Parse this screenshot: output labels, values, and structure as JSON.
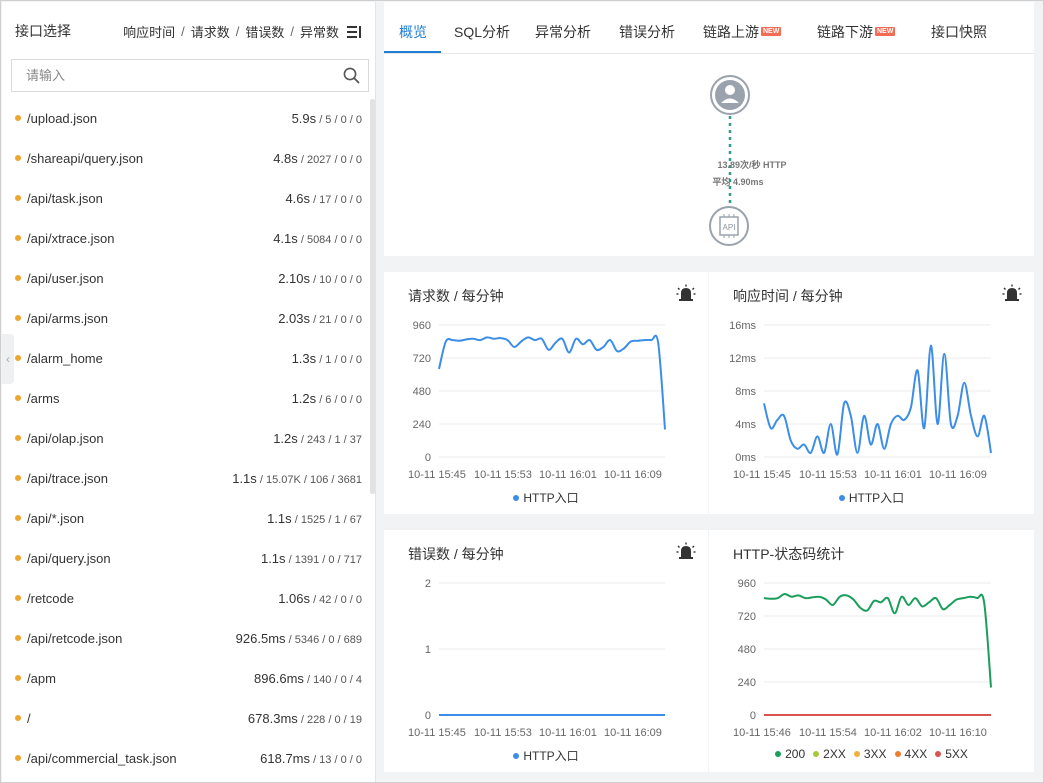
{
  "sidebar": {
    "title": "接口选择",
    "sort": {
      "response_time": "响应时间",
      "requests": "请求数",
      "errors": "错误数",
      "exceptions": "异常数",
      "separator": "/",
      "menu_icon": "list-menu-icon"
    },
    "search_placeholder": "请输入",
    "items": [
      {
        "name": "/upload.json",
        "time": "5.9s",
        "counts": " / 5 / 0 / 0"
      },
      {
        "name": "/shareapi/query.json",
        "time": "4.8s",
        "counts": " / 2027 / 0 / 0"
      },
      {
        "name": "/api/task.json",
        "time": "4.6s",
        "counts": " / 17 / 0 / 0"
      },
      {
        "name": "/api/xtrace.json",
        "time": "4.1s",
        "counts": " / 5084 / 0 / 0"
      },
      {
        "name": "/api/user.json",
        "time": "2.10s",
        "counts": " / 10 / 0 / 0"
      },
      {
        "name": "/api/arms.json",
        "time": "2.03s",
        "counts": " / 21 / 0 / 0"
      },
      {
        "name": "/alarm_home",
        "time": "1.3s",
        "counts": " / 1 / 0 / 0"
      },
      {
        "name": "/arms",
        "time": "1.2s",
        "counts": " / 6 / 0 / 0"
      },
      {
        "name": "/api/olap.json",
        "time": "1.2s",
        "counts": " / 243 / 1 / 37"
      },
      {
        "name": "/api/trace.json",
        "time": "1.1s",
        "counts": " / 15.07K / 106 / 3681"
      },
      {
        "name": "/api/*.json",
        "time": "1.1s",
        "counts": " / 1525 / 1 / 67"
      },
      {
        "name": "/api/query.json",
        "time": "1.1s",
        "counts": " / 1391 / 0 / 717"
      },
      {
        "name": "/retcode",
        "time": "1.06s",
        "counts": " / 42 / 0 / 0"
      },
      {
        "name": "/api/retcode.json",
        "time": "926.5ms",
        "counts": " / 5346 / 0 / 689"
      },
      {
        "name": "/apm",
        "time": "896.6ms",
        "counts": " / 140 / 0 / 4"
      },
      {
        "name": "/",
        "time": "678.3ms",
        "counts": " / 228 / 0 / 19"
      },
      {
        "name": "/api/commercial_task.json",
        "time": "618.7ms",
        "counts": " / 13 / 0 / 0"
      }
    ]
  },
  "tabs": [
    {
      "label": "概览",
      "active": true
    },
    {
      "label": "SQL分析"
    },
    {
      "label": "异常分析"
    },
    {
      "label": "错误分析"
    },
    {
      "label": "链路上游",
      "badge": "NEW"
    },
    {
      "label": "链路下游",
      "badge": "NEW"
    },
    {
      "label": "接口快照"
    }
  ],
  "topology": {
    "source_icon": "user-icon",
    "target_icon": "api-chip-icon",
    "target_label": "API",
    "rate_text": "13.89次/秒 HTTP",
    "avg_text": "平均 4.90ms",
    "edge_color": "#2a9d8f"
  },
  "colors": {
    "accent": "#1f7ed6",
    "series_blue": "#3b8de8",
    "status_200": "#1a9e5c",
    "status_2xx": "#a5c93b",
    "status_3xx": "#f0b03c",
    "status_4xx": "#f07d2e",
    "status_5xx": "#d9534f",
    "list_dot": "#f0a431"
  },
  "chart_data": [
    {
      "id": "requests",
      "type": "line",
      "title": "请求数 / 每分钟",
      "alarm_icon": "alarm-bell-icon",
      "yticks": [
        "960",
        "720",
        "480",
        "240",
        "0"
      ],
      "ylim": [
        0,
        960
      ],
      "xticks": [
        "10-11 15:45",
        "10-11 15:53",
        "10-11 16:01",
        "10-11 16:09"
      ],
      "series": [
        {
          "name": "HTTP入口",
          "color": "#3b8de8",
          "values": [
            640,
            840,
            850,
            845,
            855,
            860,
            850,
            870,
            860,
            865,
            850,
            800,
            840,
            870,
            850,
            860,
            780,
            830,
            860,
            760,
            860,
            820,
            850,
            780,
            800,
            850,
            770,
            790,
            840,
            845,
            850,
            850,
            830,
            200
          ]
        }
      ]
    },
    {
      "id": "response_time",
      "type": "line",
      "title": "响应时间 / 每分钟",
      "alarm_icon": "alarm-bell-icon",
      "yticks": [
        "16ms",
        "12ms",
        "8ms",
        "4ms",
        "0ms"
      ],
      "ylim": [
        0,
        16
      ],
      "xticks": [
        "10-11 15:45",
        "10-11 15:53",
        "10-11 16:01",
        "10-11 16:09"
      ],
      "series": [
        {
          "name": "HTTP入口",
          "color": "#3b8de8",
          "values": [
            6.5,
            3.5,
            4.5,
            5,
            2,
            1,
            1.5,
            0.5,
            2.5,
            0.5,
            4,
            0.3,
            6.5,
            5,
            0.5,
            5,
            1.5,
            4,
            1,
            4,
            5,
            4.5,
            6,
            10.5,
            3.5,
            13.5,
            4,
            12.5,
            4,
            5,
            9,
            5,
            2.5,
            5,
            0.5
          ]
        }
      ]
    },
    {
      "id": "errors",
      "type": "line",
      "title": "错误数 / 每分钟",
      "alarm_icon": "alarm-bell-icon",
      "yticks": [
        "2",
        "1",
        "0"
      ],
      "ylim": [
        0,
        2
      ],
      "xticks": [
        "10-11 15:45",
        "10-11 15:53",
        "10-11 16:01",
        "10-11 16:09"
      ],
      "series": [
        {
          "name": "HTTP入口",
          "color": "#3b8de8",
          "values": [
            0,
            0,
            0,
            0,
            0,
            0,
            0,
            0,
            0,
            0,
            0,
            0
          ]
        }
      ]
    },
    {
      "id": "status_codes",
      "type": "line",
      "title": "HTTP-状态码统计",
      "yticks": [
        "960",
        "720",
        "480",
        "240",
        "0"
      ],
      "ylim": [
        0,
        960
      ],
      "xticks": [
        "10-11 15:46",
        "10-11 15:54",
        "10-11 16:02",
        "10-11 16:10"
      ],
      "series": [
        {
          "name": "200",
          "color": "#1a9e5c",
          "values": [
            850,
            845,
            850,
            880,
            860,
            870,
            850,
            855,
            860,
            840,
            800,
            860,
            870,
            840,
            780,
            760,
            830,
            820,
            850,
            740,
            860,
            800,
            850,
            790,
            820,
            850,
            770,
            800,
            840,
            850,
            860,
            850,
            820,
            200
          ]
        },
        {
          "name": "2XX",
          "color": "#a5c93b",
          "values": [
            0,
            0,
            0,
            0,
            0,
            0,
            0,
            0,
            0,
            0,
            0,
            0
          ]
        },
        {
          "name": "3XX",
          "color": "#f0b03c",
          "values": [
            0,
            0,
            0,
            0,
            0,
            0,
            0,
            0,
            0,
            0,
            0,
            0
          ]
        },
        {
          "name": "4XX",
          "color": "#f07d2e",
          "values": [
            0,
            0,
            0,
            0,
            0,
            0,
            0,
            0,
            0,
            0,
            0,
            0
          ]
        },
        {
          "name": "5XX",
          "color": "#d9534f",
          "values": [
            0,
            0,
            0,
            0,
            0,
            0,
            0,
            0,
            0,
            0,
            0,
            0
          ]
        }
      ]
    }
  ]
}
